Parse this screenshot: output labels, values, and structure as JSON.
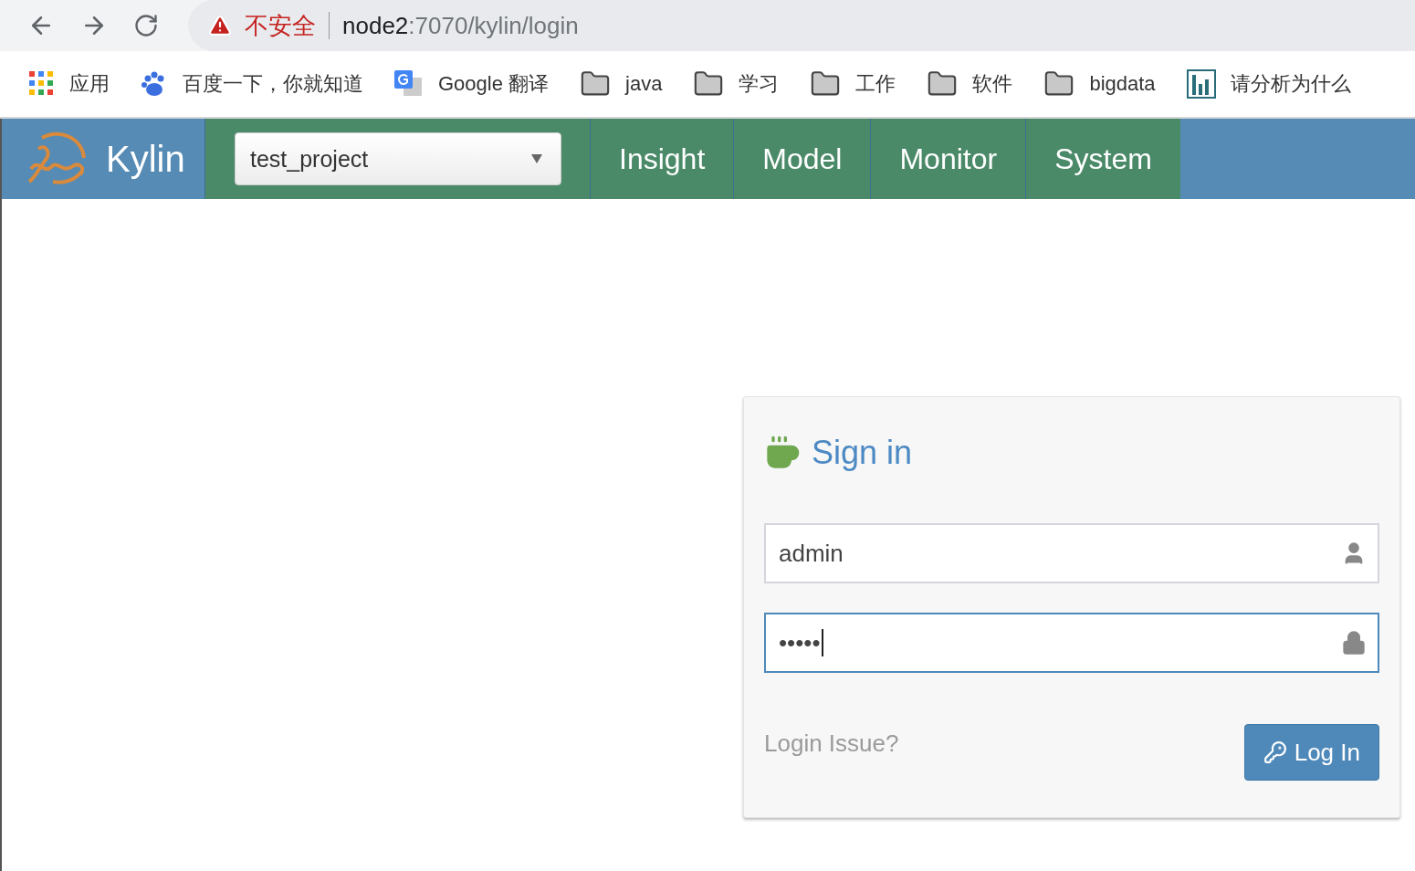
{
  "browser": {
    "security_label": "不安全",
    "url_host": "node2",
    "url_path": ":7070/kylin/login"
  },
  "bookmarks": [
    {
      "kind": "apps",
      "label": "应用"
    },
    {
      "kind": "paw",
      "label": "百度一下，你就知道"
    },
    {
      "kind": "translate",
      "label": "Google 翻译"
    },
    {
      "kind": "folder",
      "label": "java"
    },
    {
      "kind": "folder",
      "label": "学习"
    },
    {
      "kind": "folder",
      "label": "工作"
    },
    {
      "kind": "folder",
      "label": "软件"
    },
    {
      "kind": "folder",
      "label": "bigdata"
    },
    {
      "kind": "chart",
      "label": "请分析为什么"
    }
  ],
  "navbar": {
    "brand": "Kylin",
    "project": "test_project",
    "tabs": [
      {
        "label": "Insight",
        "selected": false
      },
      {
        "label": "Model",
        "selected": false
      },
      {
        "label": "Monitor",
        "selected": false
      },
      {
        "label": "System",
        "selected": false
      }
    ]
  },
  "login": {
    "title": "Sign in",
    "fields": [
      {
        "kind": "user",
        "value": "admin",
        "focused": false
      },
      {
        "kind": "password",
        "value": "•••••",
        "focused": true
      }
    ],
    "issue_link": "Login Issue?",
    "button": "Log In"
  }
}
